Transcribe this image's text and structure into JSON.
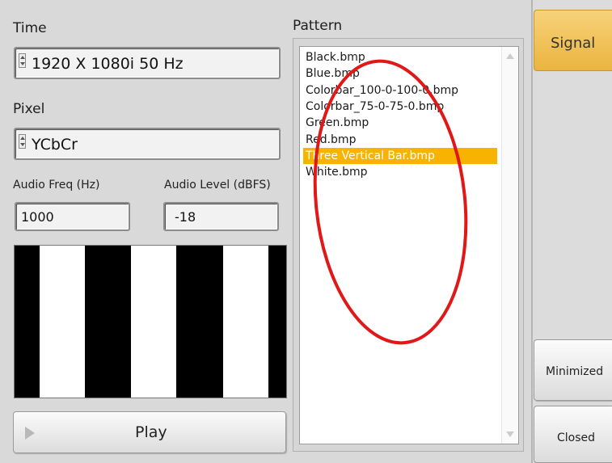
{
  "time": {
    "label": "Time",
    "value": "1920 X 1080i 50 Hz"
  },
  "pixel": {
    "label": "Pixel",
    "value": "YCbCr"
  },
  "audio_freq": {
    "label": "Audio Freq (Hz)",
    "value": "1000"
  },
  "audio_level": {
    "label": "Audio Level (dBFS)",
    "value": "-18"
  },
  "play_button": {
    "label": "Play",
    "icon": "play-icon"
  },
  "pattern": {
    "label": "Pattern",
    "items": [
      "Black.bmp",
      "Blue.bmp",
      "Colorbar_100-0-100-0.bmp",
      "Colorbar_75-0-75-0.bmp",
      "Green.bmp",
      "Red.bmp",
      "Three Vertical Bar.bmp",
      "White.bmp"
    ],
    "selected_index": 6
  },
  "side_buttons": {
    "signal": "Signal",
    "minimized": "Minimized",
    "closed": "Closed"
  },
  "colors": {
    "selection": "#f7b300",
    "signal_button": "#f2c14e",
    "annotation": "#e01818"
  }
}
